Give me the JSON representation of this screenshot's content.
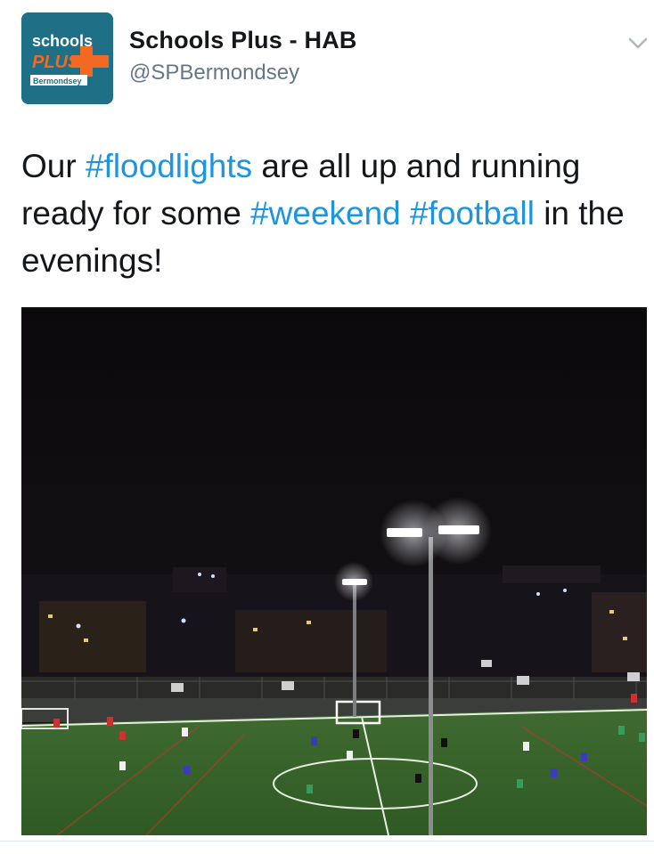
{
  "account": {
    "display_name": "Schools Plus - HAB",
    "handle": "@SPBermondsey",
    "avatar": {
      "logo_word_top": "schools",
      "logo_word_middle": "PLUS",
      "logo_word_bottom": "Bermondsey",
      "background_color": "#1f6f86",
      "accent_color": "#f26a21"
    }
  },
  "tweet": {
    "segments": [
      {
        "text": "Our ",
        "type": "text"
      },
      {
        "text": "#floodlights",
        "type": "hashtag"
      },
      {
        "text": " are all up and running ready for some ",
        "type": "text"
      },
      {
        "text": "#weekend",
        "type": "hashtag"
      },
      {
        "text": " ",
        "type": "text"
      },
      {
        "text": "#football",
        "type": "hashtag"
      },
      {
        "text": " in the evenings!",
        "type": "text"
      }
    ],
    "hashtag_color": "#1b95e0"
  },
  "media": {
    "icon": "photo",
    "description_icon": "floodlit-football-pitch-at-night"
  },
  "controls": {
    "menu_icon": "chevron-down-icon"
  }
}
